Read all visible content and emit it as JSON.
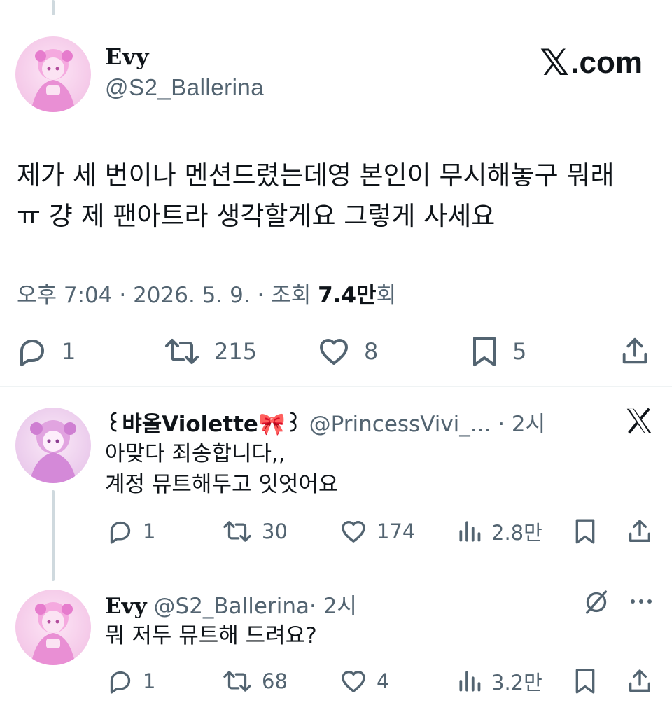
{
  "main_tweet": {
    "display_name": "Evy",
    "handle": "@S2_Ballerina",
    "site_label": ".com",
    "site_glyph": "𝕏",
    "text_line1": "제가 세 번이나 멘션드렸는데영 본인이 무시해놓구 뭐래",
    "text_line2": "ㅠ  걍 제 팬아트라 생각할게요 그렇게 사세요",
    "meta_prefix": "오후 7:04 · 2026. 5. 9. · 조회 ",
    "views_value": "7.4만",
    "views_suffix": "회",
    "actions": {
      "replies": "1",
      "retweets": "215",
      "likes": "8",
      "bookmarks": "5"
    }
  },
  "replies": [
    {
      "display_name": "꒰뱌올Violette🎀꒱",
      "handle": "@PrincessVivi_...",
      "time": "· 2시",
      "text": "아맞다 죄송합니다,,\n계정 뮤트해두고 잇엇어요",
      "actions": {
        "replies": "1",
        "retweets": "30",
        "likes": "174",
        "views": "2.8만"
      }
    },
    {
      "display_name": "Evy",
      "handle": "@S2_Ballerina",
      "time": "· 2시",
      "text": "뭐 저두 뮤트해 드려요?",
      "actions": {
        "replies": "1",
        "retweets": "68",
        "likes": "4",
        "views": "3.2만"
      }
    }
  ],
  "colors": {
    "text_primary": "#0f1419",
    "text_secondary": "#536471",
    "thread_line": "#cfd9de",
    "avatar_pink": "#f4b8e4"
  },
  "icons": [
    "reply-icon",
    "retweet-icon",
    "like-icon",
    "bookmark-icon",
    "share-icon",
    "views-icon",
    "x-logo-icon",
    "grok-icon",
    "more-icon"
  ]
}
